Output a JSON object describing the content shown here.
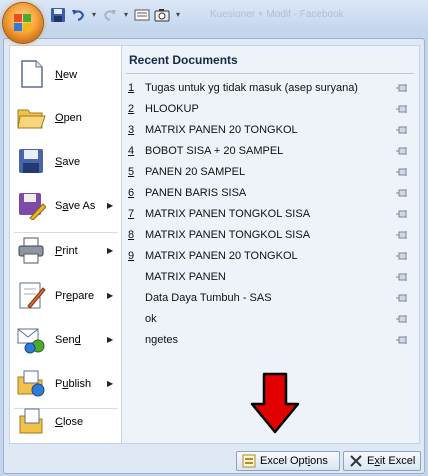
{
  "window": {
    "title_faded": "Kuesioner + Modif - Facebook"
  },
  "left_menu": [
    {
      "label": "New",
      "mnemonic": "N",
      "has_submenu": false,
      "icon": "new-document-icon"
    },
    {
      "label": "Open",
      "mnemonic": "O",
      "has_submenu": false,
      "icon": "open-folder-icon"
    },
    {
      "label": "Save",
      "mnemonic": "S",
      "has_submenu": false,
      "icon": "save-disk-icon"
    },
    {
      "label": "Save As",
      "mnemonic": "A",
      "has_submenu": true,
      "icon": "save-as-icon"
    },
    {
      "label": "Print",
      "mnemonic": "P",
      "has_submenu": true,
      "icon": "printer-icon"
    },
    {
      "label": "Prepare",
      "mnemonic": "E",
      "has_submenu": true,
      "icon": "prepare-icon"
    },
    {
      "label": "Send",
      "mnemonic": "D",
      "has_submenu": true,
      "icon": "send-icon"
    },
    {
      "label": "Publish",
      "mnemonic": "U",
      "has_submenu": true,
      "icon": "publish-icon"
    },
    {
      "label": "Close",
      "mnemonic": "C",
      "has_submenu": false,
      "icon": "close-document-icon"
    }
  ],
  "recent": {
    "title": "Recent Documents",
    "items": [
      {
        "num": "1",
        "name": "Tugas untuk yg tidak masuk (asep suryana)"
      },
      {
        "num": "2",
        "name": "HLOOKUP"
      },
      {
        "num": "3",
        "name": "MATRIX PANEN 20 TONGKOL"
      },
      {
        "num": "4",
        "name": "BOBOT SISA + 20 SAMPEL"
      },
      {
        "num": "5",
        "name": "PANEN 20 SAMPEL"
      },
      {
        "num": "6",
        "name": "PANEN BARIS SISA"
      },
      {
        "num": "7",
        "name": "MATRIX PANEN TONGKOL SISA"
      },
      {
        "num": "8",
        "name": "MATRIX PANEN TONGKOL SISA"
      },
      {
        "num": "9",
        "name": "MATRIX PANEN 20 TONGKOL"
      },
      {
        "num": "",
        "name": "MATRIX PANEN"
      },
      {
        "num": "",
        "name": "Data Daya Tumbuh - SAS"
      },
      {
        "num": "",
        "name": "ok"
      },
      {
        "num": "",
        "name": "ngetes"
      }
    ]
  },
  "buttons": {
    "options_label": "Excel Options",
    "exit_label": "Exit Excel"
  },
  "colors": {
    "annotation_arrow": "#e00000",
    "accent_orb": "#f8a23a"
  }
}
